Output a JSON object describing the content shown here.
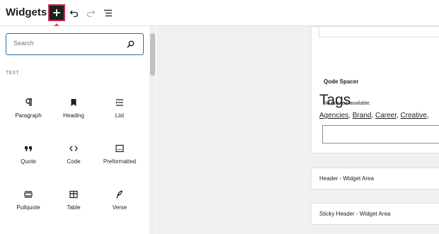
{
  "header": {
    "title": "Widgets",
    "add_icon": "plus-icon",
    "undo_icon": "undo-icon",
    "redo_icon": "redo-icon",
    "list_view_icon": "list-view-icon",
    "accent_color": "#c0314f"
  },
  "inserter": {
    "search": {
      "placeholder": "Search",
      "value": ""
    },
    "category": "TEXT",
    "blocks": [
      {
        "label": "Paragraph",
        "icon": "paragraph-icon"
      },
      {
        "label": "Heading",
        "icon": "heading-icon"
      },
      {
        "label": "List",
        "icon": "list-icon"
      },
      {
        "label": "Quote",
        "icon": "quote-icon"
      },
      {
        "label": "Code",
        "icon": "code-icon"
      },
      {
        "label": "Preformatted",
        "icon": "preformatted-icon"
      },
      {
        "label": "Pullquote",
        "icon": "pullquote-icon"
      },
      {
        "label": "Table",
        "icon": "table-icon"
      },
      {
        "label": "Verse",
        "icon": "verse-icon"
      }
    ]
  },
  "canvas": {
    "qode_spacer": {
      "title": "Qode Spacer",
      "note": "No preview available."
    },
    "tags": {
      "title": "Tags",
      "links": [
        "Agencies",
        "Brand",
        "Career",
        "Creative"
      ]
    },
    "areas": [
      {
        "label": "Header - Widget Area"
      },
      {
        "label": "Sticky Header - Widget Area"
      }
    ]
  }
}
